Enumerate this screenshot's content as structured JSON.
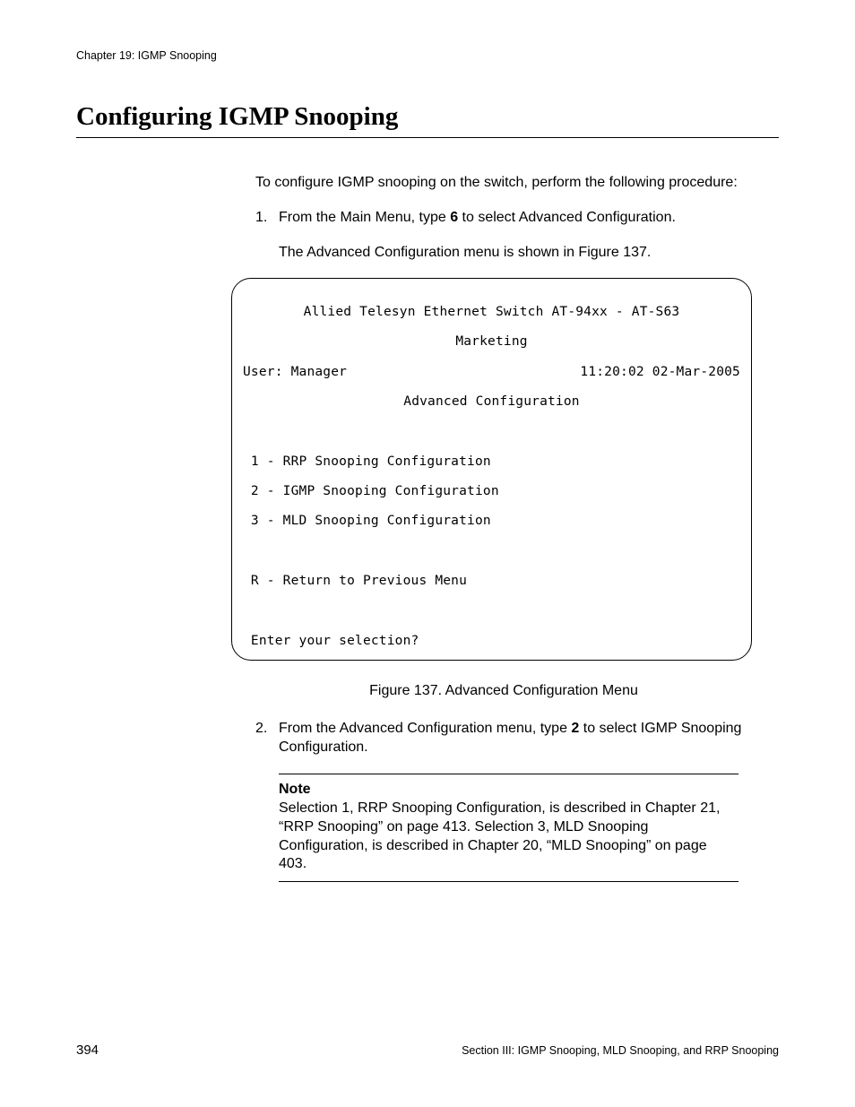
{
  "header": {
    "chapter": "Chapter 19: IGMP Snooping"
  },
  "title": "Configuring IGMP Snooping",
  "intro": "To configure IGMP snooping on the switch, perform the following procedure:",
  "steps": {
    "s1": {
      "num": "1.",
      "pre": "From the Main Menu, type ",
      "bold": "6",
      "post": " to select Advanced Configuration."
    },
    "s1_sub": "The Advanced Configuration menu is shown in Figure 137.",
    "s2": {
      "num": "2.",
      "pre": "From the Advanced Configuration menu, type ",
      "bold": "2",
      "post": " to select IGMP Snooping Configuration."
    }
  },
  "terminal": {
    "line1": "Allied Telesyn Ethernet Switch AT-94xx - AT-S63",
    "line2": "Marketing",
    "user": "User: Manager",
    "datetime": "11:20:02 02-Mar-2005",
    "menu_title": "Advanced Configuration",
    "opt1": " 1 - RRP Snooping Configuration",
    "opt2": " 2 - IGMP Snooping Configuration",
    "opt3": " 3 - MLD Snooping Configuration",
    "ret": " R - Return to Previous Menu",
    "prompt": " Enter your selection?"
  },
  "figure_caption": "Figure 137. Advanced Configuration Menu",
  "note": {
    "label": "Note",
    "body": "Selection 1, RRP Snooping Configuration, is described in Chapter 21, “RRP Snooping” on page 413. Selection 3, MLD Snooping Configuration, is described in Chapter 20, “MLD Snooping” on page 403."
  },
  "footer": {
    "page": "394",
    "section": "Section III: IGMP Snooping, MLD Snooping, and RRP Snooping"
  }
}
